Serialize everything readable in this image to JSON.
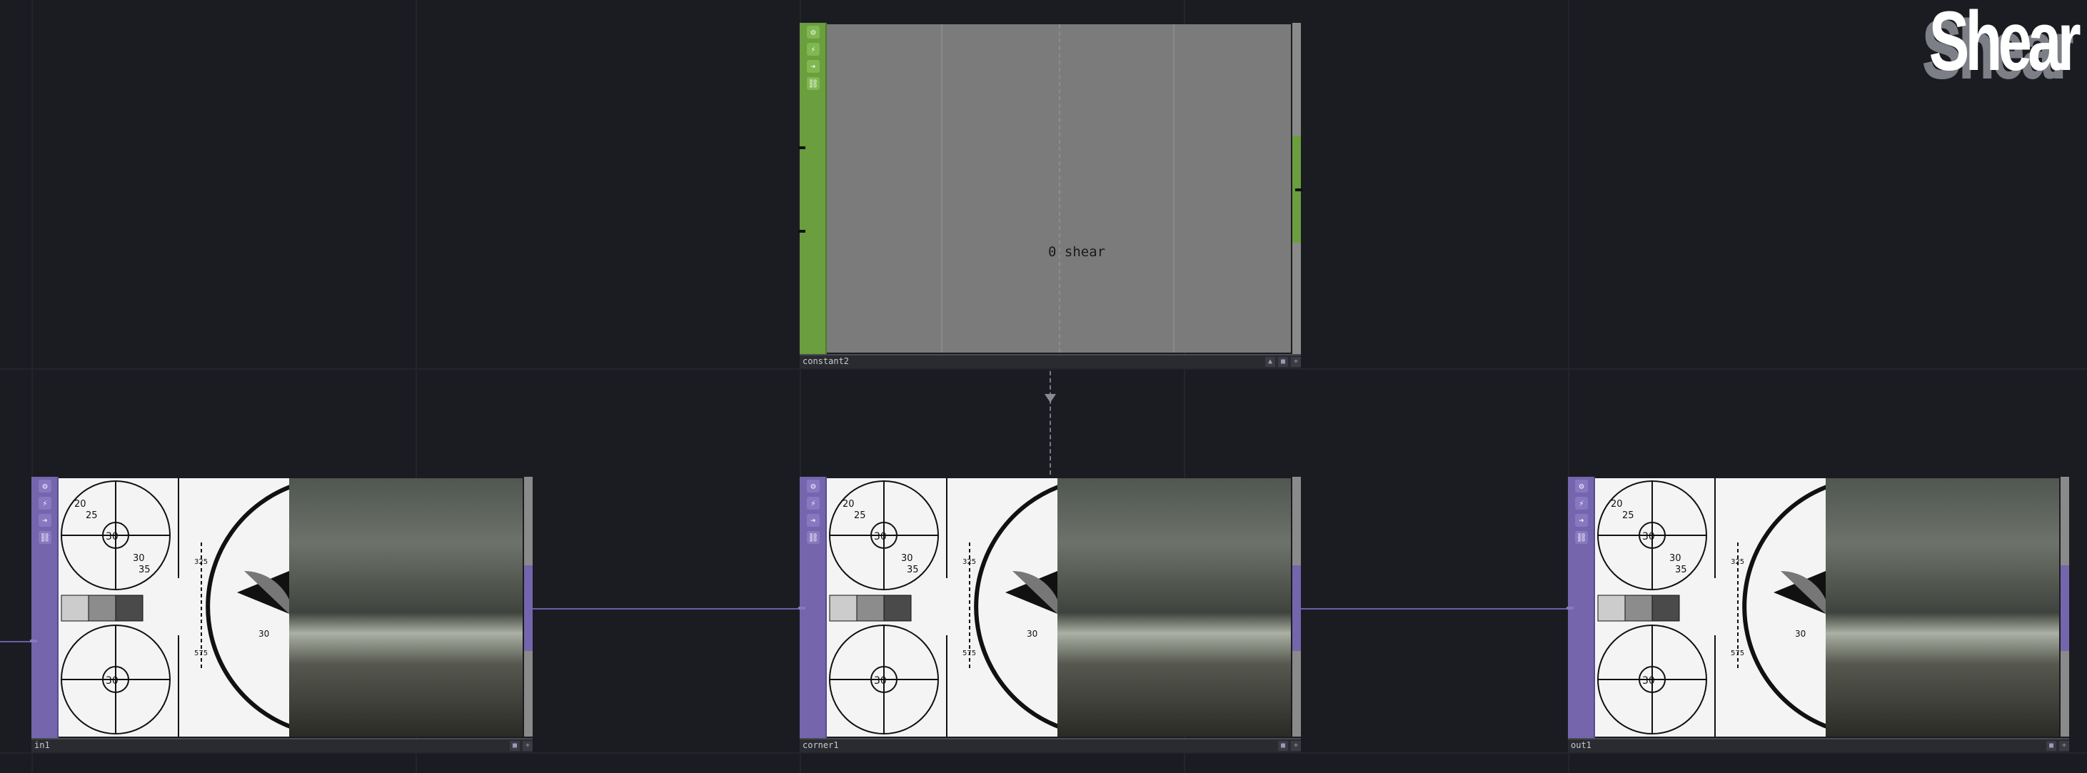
{
  "title": "Shear",
  "nodes": [
    {
      "name": "constant2",
      "viewer_text": "0 shear",
      "family": "green"
    },
    {
      "name": "in1",
      "family": "purple"
    },
    {
      "name": "corner1",
      "family": "purple"
    },
    {
      "name": "out1",
      "family": "purple"
    }
  ],
  "strip_icons": [
    "gear-icon",
    "lightning-icon",
    "arrow-right-icon",
    "link-icon"
  ],
  "test_pattern": {
    "ring_number": "30",
    "tick_labels": [
      "20",
      "25",
      "30",
      "35"
    ],
    "center_label": "30",
    "scale_top": "325",
    "scale_bottom": "575"
  },
  "colors": {
    "background": "#1b1c22",
    "top_node": "#6a9e3e",
    "filter_node": "#7565ad",
    "wire": "#6a5fa8"
  }
}
